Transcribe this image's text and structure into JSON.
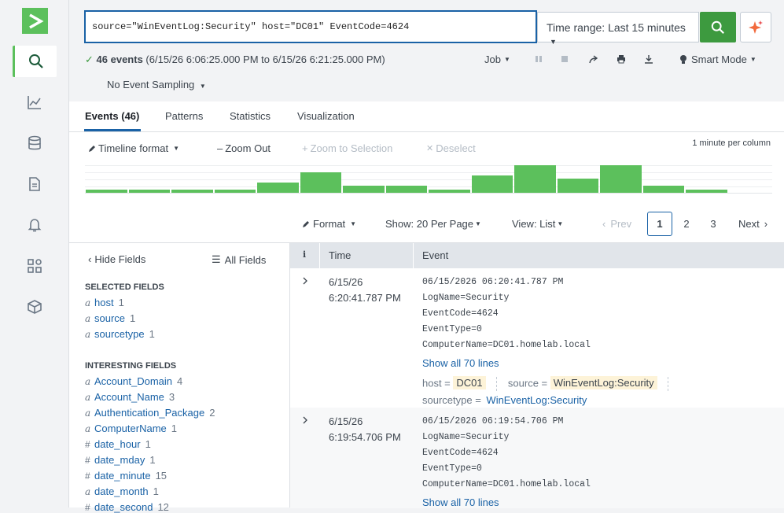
{
  "search": {
    "query": "source=\"WinEventLog:Security\" host=\"DC01\" EventCode=4624",
    "time_range": "Time range: Last 15 minutes"
  },
  "status": {
    "events_count": "46 events",
    "range_text": "(6/15/26 6:06:25.000 PM to 6/15/26 6:21:25.000 PM)",
    "job_label": "Job",
    "mode_label": "Smart Mode",
    "sampling_label": "No Event Sampling"
  },
  "tabs": [
    {
      "label": "Events (46)"
    },
    {
      "label": "Patterns"
    },
    {
      "label": "Statistics"
    },
    {
      "label": "Visualization"
    }
  ],
  "timeline": {
    "format_label": "Timeline format",
    "zoom_out": "Zoom Out",
    "zoom_selection": "Zoom to Selection",
    "deselect": "Deselect",
    "scale": "1 minute per column",
    "bars": [
      1,
      1,
      1,
      1,
      3,
      6,
      2,
      2,
      1,
      5,
      8,
      4,
      8,
      2,
      1
    ],
    "max": 8
  },
  "results_toolbar": {
    "format": "Format",
    "show": "Show: 20 Per Page",
    "view": "View: List",
    "prev": "Prev",
    "pages": [
      "1",
      "2",
      "3"
    ],
    "next": "Next"
  },
  "fields": {
    "hide": "Hide Fields",
    "all": "All Fields",
    "selected_title": "SELECTED FIELDS",
    "selected": [
      {
        "type": "a",
        "name": "host",
        "count": "1"
      },
      {
        "type": "a",
        "name": "source",
        "count": "1"
      },
      {
        "type": "a",
        "name": "sourcetype",
        "count": "1"
      }
    ],
    "interesting_title": "INTERESTING FIELDS",
    "interesting": [
      {
        "type": "a",
        "name": "Account_Domain",
        "count": "4"
      },
      {
        "type": "a",
        "name": "Account_Name",
        "count": "3"
      },
      {
        "type": "a",
        "name": "Authentication_Package",
        "count": "2"
      },
      {
        "type": "a",
        "name": "ComputerName",
        "count": "1"
      },
      {
        "type": "#",
        "name": "date_hour",
        "count": "1"
      },
      {
        "type": "#",
        "name": "date_mday",
        "count": "1"
      },
      {
        "type": "#",
        "name": "date_minute",
        "count": "15"
      },
      {
        "type": "a",
        "name": "date_month",
        "count": "1"
      },
      {
        "type": "#",
        "name": "date_second",
        "count": "12"
      }
    ]
  },
  "events_table": {
    "col_info": "i",
    "col_time": "Time",
    "col_event": "Event",
    "rows": [
      {
        "date": "6/15/26",
        "time": "6:20:41.787 PM",
        "lines": [
          "06/15/2026 06:20:41.787 PM",
          "LogName=Security",
          "EventCode=4624",
          "EventType=0",
          "ComputerName=DC01.homelab.local"
        ],
        "show_all": "Show all 70 lines",
        "host_key": "host =",
        "host_val": "DC01",
        "source_key": "source =",
        "source_val": "WinEventLog:Security",
        "sourcetype_key": "sourcetype =",
        "sourcetype_val": "WinEventLog:Security"
      },
      {
        "date": "6/15/26",
        "time": "6:19:54.706 PM",
        "lines": [
          "06/15/2026 06:19:54.706 PM",
          "LogName=Security",
          "EventCode=4624",
          "EventType=0",
          "ComputerName=DC01.homelab.local"
        ],
        "show_all": "Show all 70 lines"
      }
    ]
  }
}
